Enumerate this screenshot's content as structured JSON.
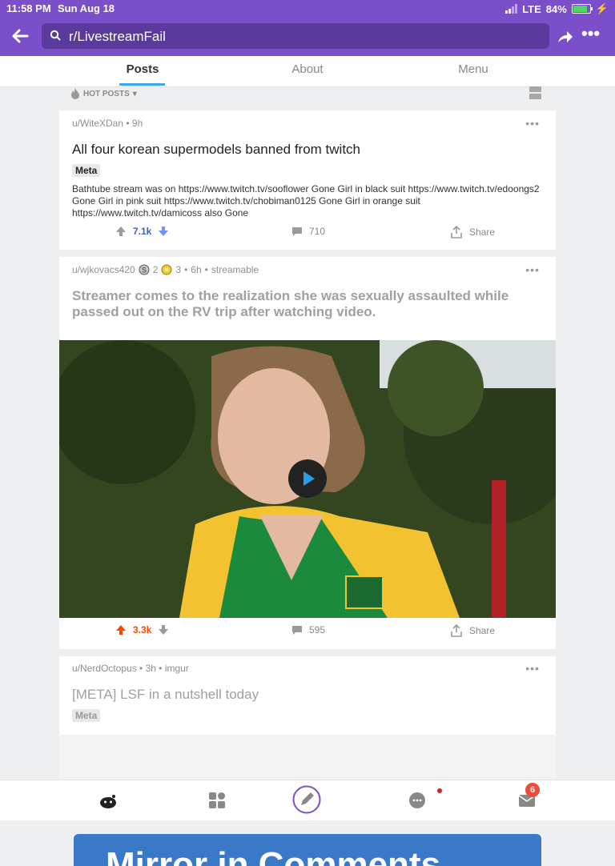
{
  "status_bar": {
    "time": "11:58 PM",
    "date": "Sun Aug 18",
    "network": "LTE",
    "battery": "84%",
    "battery_level": 0.84
  },
  "header": {
    "search_value": "r/LivestreamFail"
  },
  "tabs": [
    {
      "label": "Posts",
      "active": true
    },
    {
      "label": "About",
      "active": false
    },
    {
      "label": "Menu",
      "active": false
    }
  ],
  "sort": {
    "label": "HOT POSTS"
  },
  "posts": [
    {
      "author": "u/WiteXDan",
      "age": "9h",
      "title": "All four korean supermodels banned from twitch",
      "flair": "Meta",
      "body": "Bathtube stream was on  https://www.twitch.tv/sooflower Gone Girl in black suit  https://www.twitch.tv/edoongs2  Gone Girl in pink suit  https://www.twitch.tv/chobiman0125  Gone Girl in orange suit  https://www.twitch.tv/damicoss  also Gone",
      "score": "7.1k",
      "comments": "710",
      "share": "Share"
    },
    {
      "author": "u/wjkovacs420",
      "award1_count": "2",
      "award2_count": "3",
      "age": "6h",
      "domain": "streamable",
      "title": "Streamer comes to the realization she was sexually assaulted while passed out on the RV trip after watching video.",
      "score": "3.3k",
      "comments": "595",
      "share": "Share"
    },
    {
      "author": "u/NerdOctopus",
      "age": "3h",
      "domain": "imgur",
      "title": "[META] LSF in a nutshell today",
      "flair": "Meta",
      "preview_text": "Mirror in Comments"
    }
  ],
  "bottom_nav": {
    "inbox_badge": "6"
  },
  "colors": {
    "header": "#7a4fc9",
    "upvote_active": "#ff4500",
    "downvote_active": "#7193ff",
    "tab_indicator": "#3ea8e6"
  }
}
